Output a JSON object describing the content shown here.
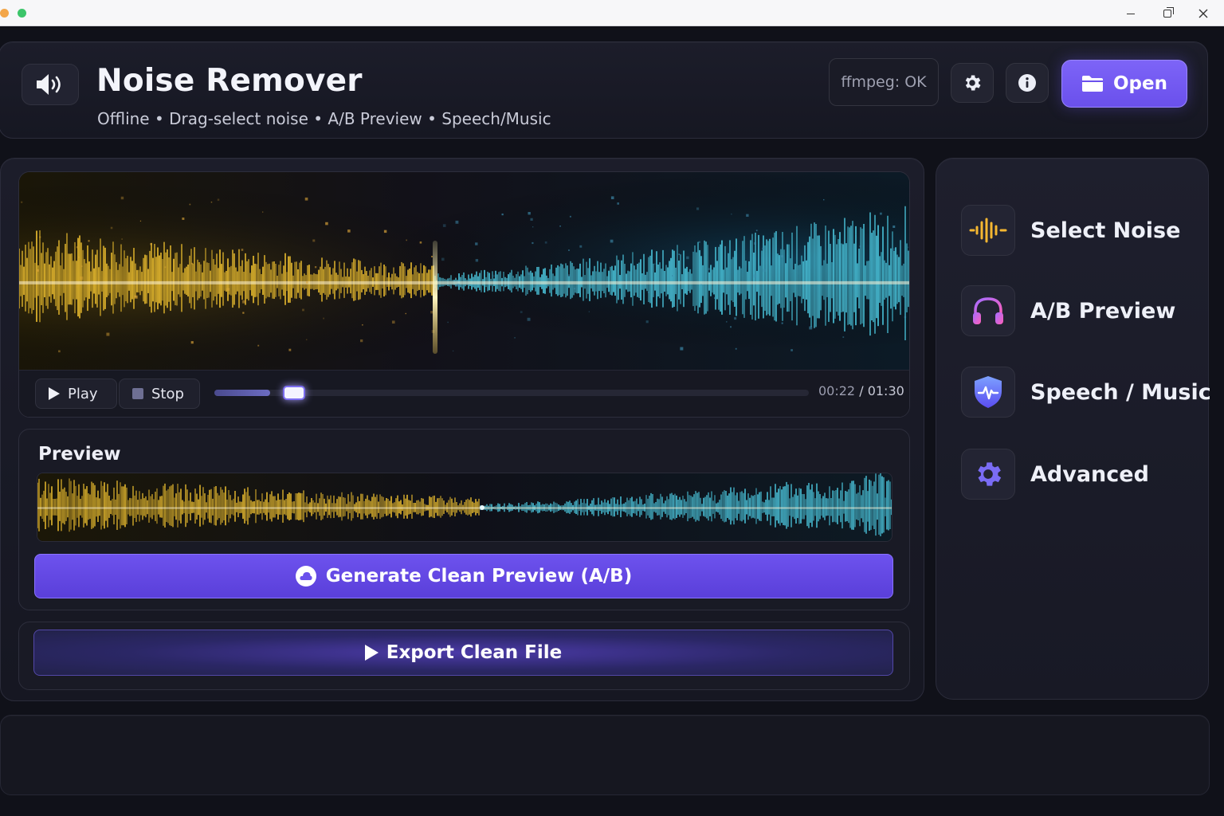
{
  "window": {
    "minimize_icon": "minimize-icon",
    "maximize_icon": "maximize-icon",
    "close_icon": "close-icon"
  },
  "header": {
    "title": "Noise Remover",
    "subtitle": "Offline • Drag-select noise • A/B Preview • Speech/Music",
    "status": "ffmpeg: OK",
    "open_label": "Open",
    "app_icon": "speaker-icon",
    "settings_icon": "gear-icon",
    "info_icon": "info-icon",
    "open_icon": "folder-icon"
  },
  "transport": {
    "play_label": "Play",
    "stop_label": "Stop",
    "current_time": "00:22",
    "separator": "/",
    "total_time": "01:30",
    "progress": 0.12
  },
  "preview": {
    "title": "Preview",
    "generate_label": "Generate Clean Preview (A/B)"
  },
  "export": {
    "label": "Export Clean File"
  },
  "sidebar": {
    "items": [
      {
        "label": "Select Noise",
        "icon": "waveform-icon"
      },
      {
        "label": "A/B Preview",
        "icon": "headphones-icon"
      },
      {
        "label": "Speech / Music",
        "icon": "shield-pulse-icon"
      },
      {
        "label": "Advanced",
        "icon": "gear-icon"
      }
    ]
  },
  "colors": {
    "accent": "#6a50ec",
    "noisy_wave": "#f5c531",
    "clean_wave": "#4fd0e8"
  }
}
